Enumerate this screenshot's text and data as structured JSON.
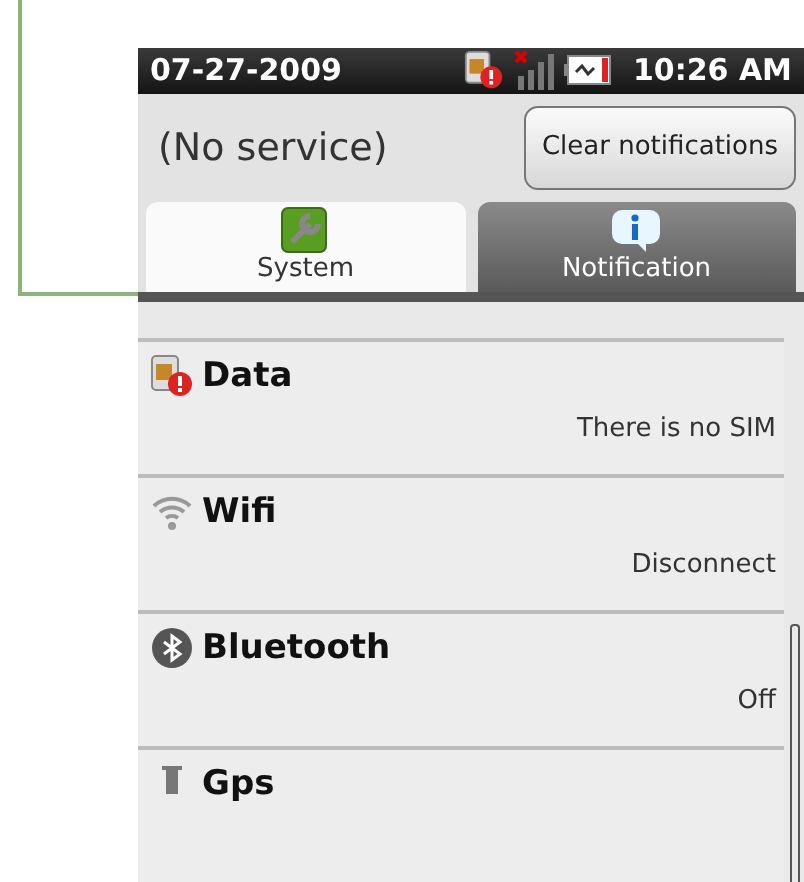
{
  "status_bar": {
    "date": "07-27-2009",
    "time": "10:26 AM"
  },
  "header": {
    "carrier": "(No service)",
    "clear_button": "Clear notifications"
  },
  "tabs": [
    {
      "label": "System",
      "selected": true
    },
    {
      "label": "Notification",
      "selected": false
    }
  ],
  "items": [
    {
      "title": "Data",
      "status": "There is no SIM"
    },
    {
      "title": "Wifi",
      "status": "Disconnect"
    },
    {
      "title": "Bluetooth",
      "status": "Off"
    },
    {
      "title": "Gps"
    }
  ]
}
